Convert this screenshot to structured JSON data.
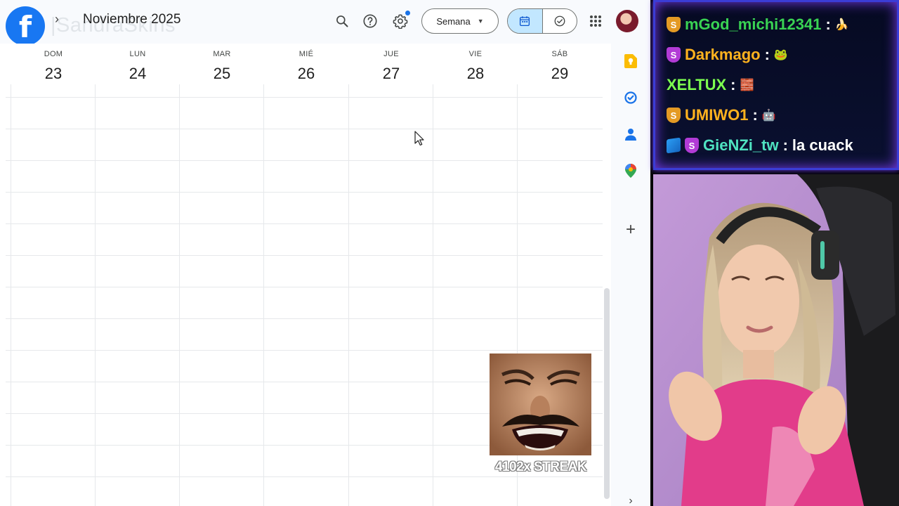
{
  "topbar": {
    "watermark": "|SandraSkins",
    "nav_next_glyph": "›",
    "month_title": "Noviembre 2025",
    "view_select": "Semana",
    "icons": [
      "facebook-logo",
      "search-icon",
      "help-icon",
      "gear-icon",
      "calendar-icon",
      "task-check-icon",
      "apps-grid-icon"
    ]
  },
  "days": [
    {
      "name": "DOM",
      "num": "23"
    },
    {
      "name": "LUN",
      "num": "24"
    },
    {
      "name": "MAR",
      "num": "25"
    },
    {
      "name": "MIÉ",
      "num": "26"
    },
    {
      "name": "JUE",
      "num": "27"
    },
    {
      "name": "VIE",
      "num": "28"
    },
    {
      "name": "SÁB",
      "num": "29"
    }
  ],
  "side_panel": {
    "icons": [
      "keep-icon",
      "tasks-icon",
      "contacts-icon",
      "maps-icon",
      "add-icon",
      "expand-icon"
    ],
    "add_glyph": "+",
    "expand_glyph": "›"
  },
  "overlay": {
    "streak": "4102x STREAK"
  },
  "chat": [
    {
      "badge": "S",
      "user": "mGod_michi12341",
      "sep": " :",
      "message": "",
      "emote": "🍌",
      "user_color": "#39d353",
      "badge_type": "gold"
    },
    {
      "badge": "S",
      "user": "Darkmago",
      "sep": " :",
      "message": "",
      "emote": "🐸",
      "user_color": "#ffb21e",
      "badge_type": "purple"
    },
    {
      "badge": "",
      "user": "XELTUX",
      "sep": " :",
      "message": "",
      "emote": "🧱",
      "user_color": "#7dff4f",
      "badge_type": "none"
    },
    {
      "badge": "S",
      "user": "UMIWO1",
      "sep": " :",
      "message": "",
      "emote": "🤖",
      "user_color": "#ffb21e",
      "badge_type": "gold"
    },
    {
      "badge": "S",
      "user": "GieNZi_tw",
      "sep": " :",
      "message": "la cuack",
      "emote": "",
      "user_color": "#4fe3c1",
      "badge_type": "purple"
    }
  ],
  "colors": {
    "accent": "#1a73e8",
    "selected_mode": "#c2e7ff",
    "chat_border": "#3b3dd6",
    "chat_bg": "#060a22"
  }
}
